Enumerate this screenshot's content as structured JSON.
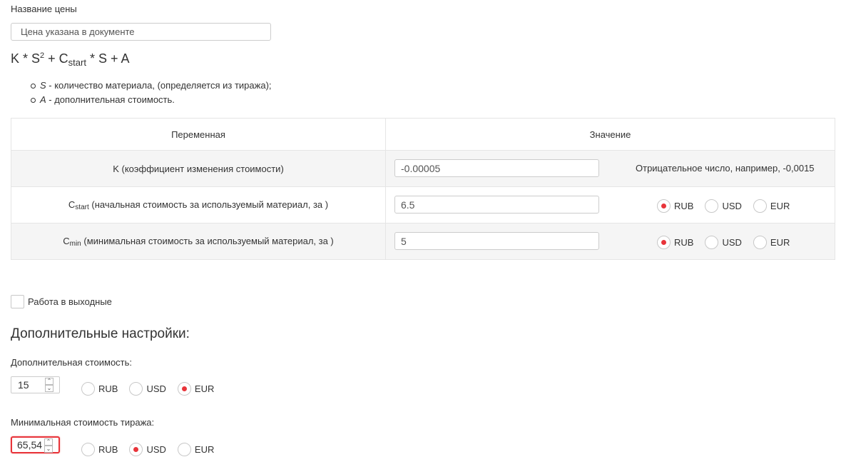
{
  "price_name": {
    "label": "Название цены",
    "value": "Цена указана в документе"
  },
  "formula": {
    "part1": "K * S",
    "sup": "2",
    "part2": " + C",
    "sub": "start",
    "part3": " * S + A"
  },
  "legend": [
    {
      "var": "S",
      "text": " - количество материала, (определяется из тиража);"
    },
    {
      "var": "A",
      "text": " - дополнительная стоимость."
    }
  ],
  "table": {
    "headers": [
      "Переменная",
      "Значение"
    ],
    "rows": [
      {
        "name": "K (коэффициент изменения стоимости)",
        "value": "-0.00005",
        "hint": "Отрицательное число, например, -0,0015"
      },
      {
        "name_main": "C",
        "name_sub": "start",
        "name_rest": " (начальная стоимость за используемый материал, за )",
        "value": "6.5",
        "currencies": [
          "RUB",
          "USD",
          "EUR"
        ],
        "selected": "RUB"
      },
      {
        "name_main": "C",
        "name_sub": "min",
        "name_rest": " (минимальная стоимость за используемый материал, за )",
        "value": "5",
        "currencies": [
          "RUB",
          "USD",
          "EUR"
        ],
        "selected": "RUB"
      }
    ]
  },
  "weekend": {
    "label": "Работа в выходные",
    "checked": false
  },
  "extra": {
    "title": "Дополнительные настройки:",
    "additional_cost": {
      "label": "Дополнительная стоимость:",
      "value": "15",
      "currencies": [
        "RUB",
        "USD",
        "EUR"
      ],
      "selected": "EUR"
    },
    "min_run_cost": {
      "label": "Минимальная стоимость тиража:",
      "value": "65,54",
      "currencies": [
        "RUB",
        "USD",
        "EUR"
      ],
      "selected": "USD"
    }
  },
  "colors": {
    "accent": "#e8343a",
    "row_alt": "#f5f5f5",
    "border": "#e5e5e5"
  },
  "icons": {
    "spinner_up": "chevron-up-icon",
    "spinner_down": "chevron-down-icon"
  }
}
